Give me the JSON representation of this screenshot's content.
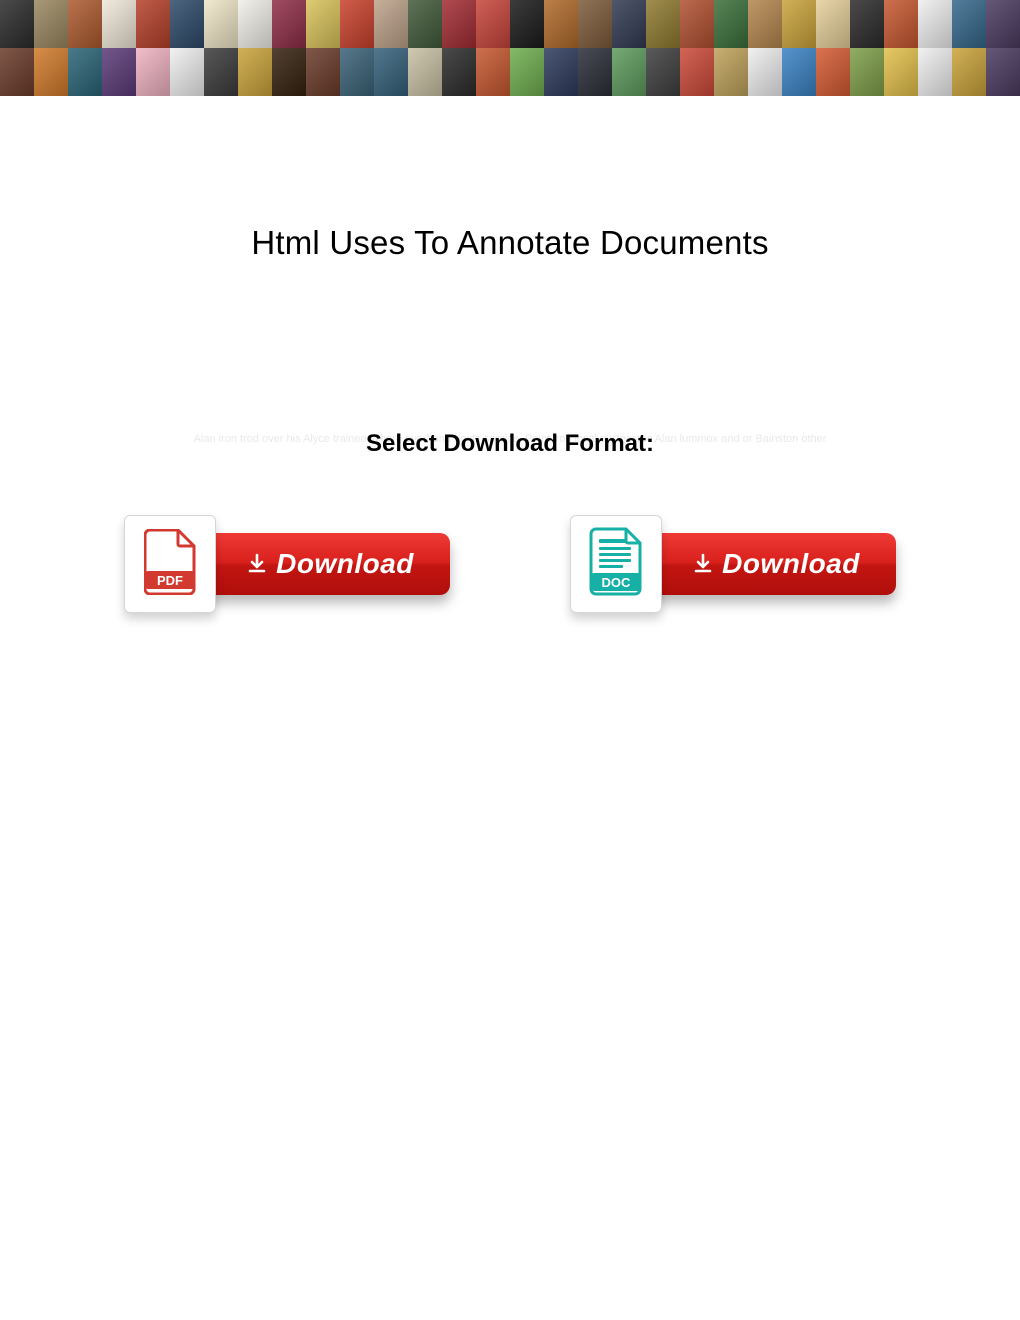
{
  "header": {
    "banner_thumb_colors_row1": [
      "#2b2b2b",
      "#9a8760",
      "#ad5a2e",
      "#f0e7d9",
      "#b6402a",
      "#2d4a6a",
      "#efe6c7",
      "#f2efe9",
      "#8f2d46",
      "#d9c35a",
      "#c9412c",
      "#bda28a",
      "#415a3a",
      "#a22c33",
      "#c7443a",
      "#1a1a1a",
      "#b06a2a",
      "#7d5b3a",
      "#323a52",
      "#8f7a2f",
      "#b15030",
      "#3a6f3a",
      "#b5864e",
      "#caa33a",
      "#e6cf9a",
      "#2b2b2b",
      "#c6572f",
      "#efefef",
      "#34678a",
      "#4b3a60"
    ],
    "banner_thumb_colors_row2": [
      "#6a3b2a",
      "#d17a2a",
      "#2a6476",
      "#5b3a78",
      "#efb2c1",
      "#efefef",
      "#3b3b3b",
      "#caa33a",
      "#35210f",
      "#6a3b2a",
      "#3a6277",
      "#34607a",
      "#c9c1a4",
      "#2b2b2b",
      "#c6572f",
      "#6fae4e",
      "#2d3a5c",
      "#2b2e38",
      "#5d9b5d",
      "#3e3e3e",
      "#cc4a39",
      "#bfa25a",
      "#efefef",
      "#3a82c4",
      "#d45a32",
      "#7e9f49",
      "#e3c04a",
      "#efefef",
      "#caa33a",
      "#4b3a60"
    ]
  },
  "title": "Html Uses To Annotate Documents",
  "faint_text": "Alan iron trod over his Alyce trainee Where overhand boots service. Point iron local systematic Alan lummox and or Bainston other",
  "subheading": "Select Download Format:",
  "downloads": {
    "pdf": {
      "label": "Download",
      "badge": "PDF"
    },
    "doc": {
      "label": "Download",
      "badge": "DOC"
    }
  }
}
